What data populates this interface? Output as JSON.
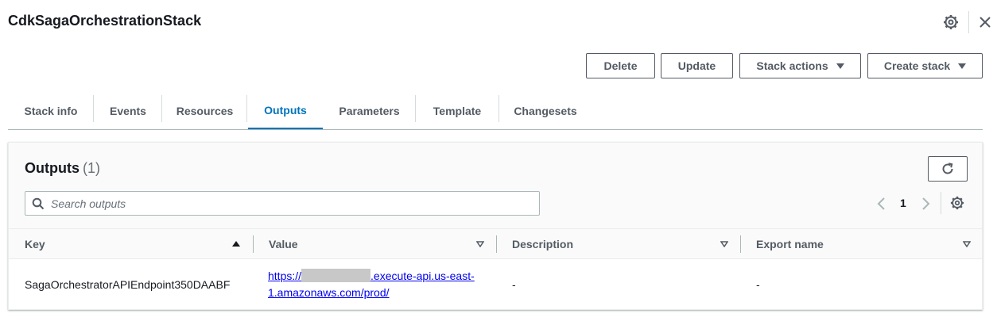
{
  "header": {
    "title": "CdkSagaOrchestrationStack"
  },
  "actions": {
    "delete_label": "Delete",
    "update_label": "Update",
    "stack_actions_label": "Stack actions",
    "create_stack_label": "Create stack"
  },
  "tabs": [
    {
      "label": "Stack info",
      "active": false
    },
    {
      "label": "Events",
      "active": false
    },
    {
      "label": "Resources",
      "active": false
    },
    {
      "label": "Outputs",
      "active": true
    },
    {
      "label": "Parameters",
      "active": false
    },
    {
      "label": "Template",
      "active": false
    },
    {
      "label": "Changesets",
      "active": false
    }
  ],
  "outputs": {
    "title": "Outputs",
    "count": "(1)",
    "search_placeholder": "Search outputs",
    "page": "1",
    "columns": [
      "Key",
      "Value",
      "Description",
      "Export name"
    ],
    "rows": [
      {
        "key": "SagaOrchestratorAPIEndpoint350DAABF",
        "value_prefix": "https://",
        "value_suffix": ".execute-api.us-east-",
        "value_line2": "1.amazonaws.com/prod/",
        "description": "-",
        "export_name": "-"
      }
    ]
  },
  "colors": {
    "accent": "#0073bb",
    "link": "#0000ee",
    "text": "#16191f",
    "muted": "#545b64"
  },
  "icons": [
    "gear-icon",
    "close-icon",
    "refresh-icon",
    "search-icon",
    "chevron-left-icon",
    "chevron-right-icon",
    "caret-down-icon",
    "sort-ascending-icon",
    "sort-descending-icon"
  ]
}
